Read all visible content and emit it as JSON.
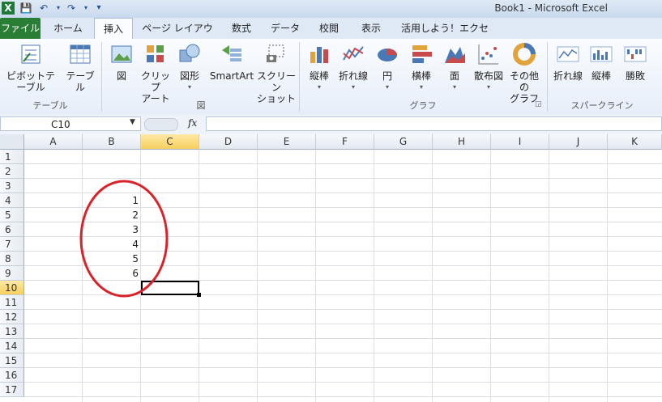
{
  "window": {
    "title": "Book1  -  Microsoft Excel"
  },
  "tabs": [
    "ファイル",
    "ホーム",
    "挿入",
    "ページ レイアウト",
    "数式",
    "データ",
    "校閲",
    "表示",
    "活用しよう！エクセル"
  ],
  "ribbon": {
    "groups": {
      "table": "テーブル",
      "illust": "図",
      "graph": "グラフ",
      "sparkline": "スパークライン"
    },
    "buttons": {
      "pivot": "ピボットテーブル",
      "table": "テーブル",
      "picture": "図",
      "clip1": "クリップ",
      "clip2": "アート",
      "shape": "図形",
      "smartart": "SmartArt",
      "screenshot1": "スクリーン",
      "screenshot2": "ショット",
      "col": "縦棒",
      "line": "折れ線",
      "pie": "円",
      "bar": "横棒",
      "area": "面",
      "scatter": "散布図",
      "other1": "その他の",
      "other2": "グラフ",
      "sp_line": "折れ線",
      "sp_col": "縦棒",
      "sp_wl": "勝敗"
    }
  },
  "formula_bar": {
    "name_box": "C10",
    "fx": "fx",
    "formula": ""
  },
  "sheet": {
    "columns": [
      "A",
      "B",
      "C",
      "D",
      "E",
      "F",
      "G",
      "H",
      "I",
      "J",
      "K"
    ],
    "rows": [
      "1",
      "2",
      "3",
      "4",
      "5",
      "6",
      "7",
      "8",
      "9",
      "10",
      "11",
      "12",
      "13",
      "14",
      "15",
      "16",
      "17"
    ],
    "selected_cell": "C10",
    "cells": [
      {
        "ref": "B4",
        "value": "1"
      },
      {
        "ref": "B5",
        "value": "2"
      },
      {
        "ref": "B6",
        "value": "3"
      },
      {
        "ref": "B7",
        "value": "4"
      },
      {
        "ref": "B8",
        "value": "5"
      },
      {
        "ref": "B9",
        "value": "6"
      }
    ]
  },
  "colors": {
    "file_tab": "#2a7d34",
    "annotation": "#d8232a",
    "selection_header": "#f7cf5e"
  }
}
